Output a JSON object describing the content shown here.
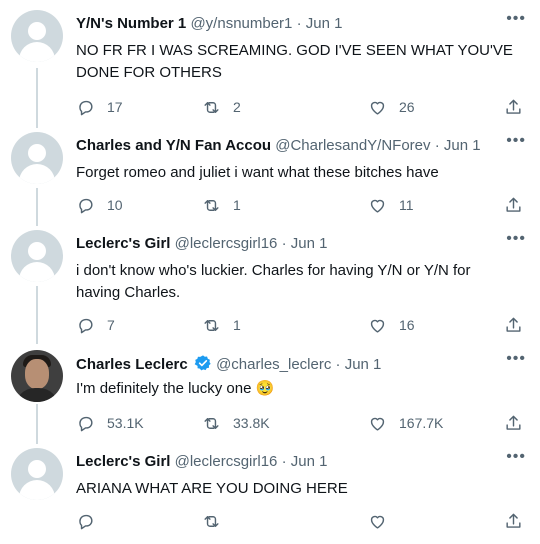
{
  "tweets": [
    {
      "name": "Y/N's Number 1",
      "handle": "@y/nsnumber1",
      "date": "Jun 1",
      "text": "NO FR FR I WAS SCREAMING. GOD I'VE SEEN WHAT YOU'VE DONE FOR OTHERS",
      "replies": "17",
      "retweets": "2",
      "likes": "26"
    },
    {
      "name": "Charles and Y/N Fan Accou",
      "handle": "@CharlesandY/NForev",
      "date": "Jun 1",
      "text": "Forget romeo and juliet i want what these bitches have",
      "replies": "10",
      "retweets": "1",
      "likes": "11"
    },
    {
      "name": "Leclerc's Girl",
      "handle": "@leclercsgirl16",
      "date": "Jun 1",
      "text": "i don't know who's luckier. Charles for having Y/N or Y/N for having Charles.",
      "replies": "7",
      "retweets": "1",
      "likes": "16"
    },
    {
      "name": "Charles Leclerc",
      "handle": "@charles_leclerc",
      "date": "Jun 1",
      "text": "I'm definitely the lucky one 🥹",
      "replies": "53.1K",
      "retweets": "33.8K",
      "likes": "167.7K"
    },
    {
      "name": "Leclerc's Girl",
      "handle": "@leclercsgirl16",
      "date": "Jun 1",
      "text": "ARIANA WHAT ARE YOU DOING HERE",
      "replies": "",
      "retweets": "",
      "likes": ""
    }
  ],
  "separator": "·",
  "more_glyph": "•••",
  "colors": {
    "text": "#0f1419",
    "secondary": "#536471",
    "thread_line": "#cfd9de",
    "verified": "#1d9bf0"
  },
  "icons": [
    "reply-icon",
    "retweet-icon",
    "like-icon",
    "share-icon",
    "verified-badge-icon",
    "more-icon"
  ]
}
